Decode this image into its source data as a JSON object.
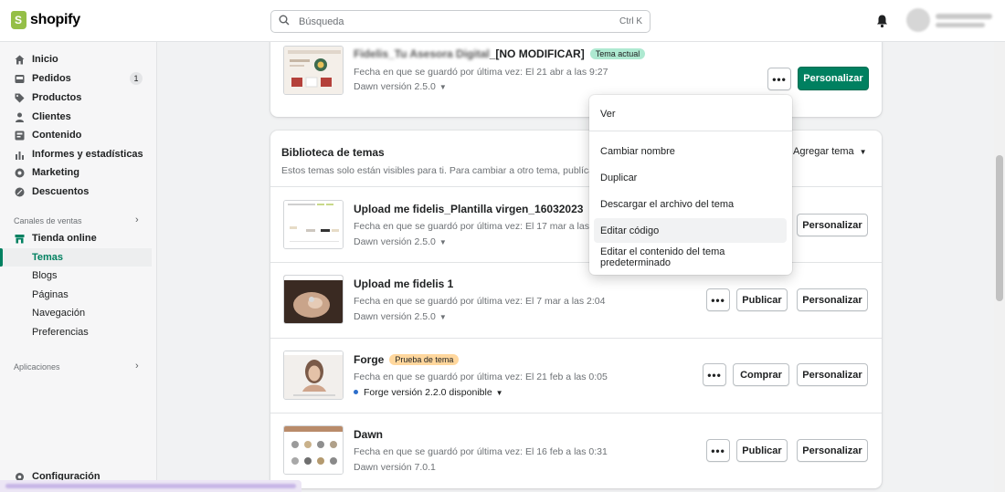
{
  "app": {
    "brand": "shopify",
    "accent": "#008060"
  },
  "search": {
    "placeholder": "Búsqueda",
    "shortcut": "Ctrl K"
  },
  "sidebar": {
    "items": [
      {
        "label": "Inicio",
        "icon": "home-icon"
      },
      {
        "label": "Pedidos",
        "icon": "orders-icon",
        "badge": "1"
      },
      {
        "label": "Productos",
        "icon": "tag-icon"
      },
      {
        "label": "Clientes",
        "icon": "person-icon"
      },
      {
        "label": "Contenido",
        "icon": "content-icon"
      },
      {
        "label": "Informes y estadísticas",
        "icon": "analytics-icon"
      },
      {
        "label": "Marketing",
        "icon": "marketing-icon"
      },
      {
        "label": "Descuentos",
        "icon": "discount-icon"
      }
    ],
    "sales_channels_label": "Canales de ventas",
    "online_store_label": "Tienda online",
    "online_store_sub": [
      "Temas",
      "Blogs",
      "Páginas",
      "Navegación",
      "Preferencias"
    ],
    "apps_label": "Aplicaciones",
    "settings_label": "Configuración"
  },
  "current_theme": {
    "name_suffix": "_[NO MODIFICAR]",
    "badge": "Tema actual",
    "saved": "Fecha en que se guardó por última vez: El 21 abr a las 9:27",
    "version": "Dawn versión 2.5.0",
    "customize_label": "Personalizar"
  },
  "library": {
    "title": "Biblioteca de temas",
    "subtitle": "Estos temas solo están visibles para ti. Para cambiar a otro tema, publícalo en",
    "add_theme_label": "Agregar tema",
    "themes": [
      {
        "name": "Upload me fidelis_Plantilla virgen_16032023",
        "saved": "Fecha en que se guardó por última vez: El 17 mar a las 16:5",
        "version": "Dawn versión 2.5.0",
        "action": "",
        "customize": "Personalizar"
      },
      {
        "name": "Upload me fidelis 1",
        "saved": "Fecha en que se guardó por última vez: El 7 mar a las 2:04",
        "version": "Dawn versión 2.5.0",
        "action": "Publicar",
        "customize": "Personalizar"
      },
      {
        "name": "Forge",
        "badge": "Prueba de tema",
        "saved": "Fecha en que se guardó por última vez: El 21 feb a las 0:05",
        "version": "Forge versión 2.2.0 disponible",
        "action": "Comprar",
        "customize": "Personalizar"
      },
      {
        "name": "Dawn",
        "saved": "Fecha en que se guardó por última vez: El 16 feb a las 0:31",
        "version": "Dawn versión 7.0.1",
        "action": "Publicar",
        "customize": "Personalizar"
      }
    ]
  },
  "menu": {
    "items": [
      "Ver",
      "Cambiar nombre",
      "Duplicar",
      "Descargar el archivo del tema",
      "Editar código",
      "Editar el contenido del tema predeterminado"
    ],
    "hovered": "Editar código"
  }
}
